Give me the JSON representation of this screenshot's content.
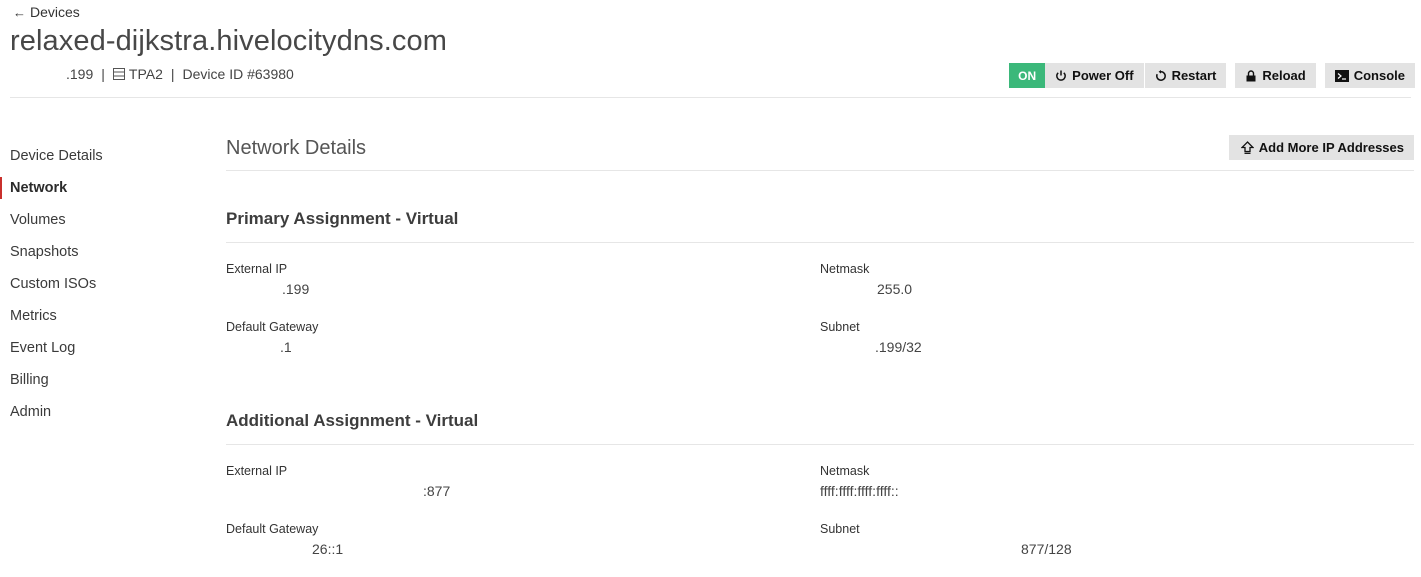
{
  "header": {
    "back_label": "Devices",
    "hostname": "relaxed-dijkstra.hivelocitydns.com",
    "ip_suffix": ".199",
    "location": "TPA2",
    "device_id": "Device ID #63980",
    "separator": "|"
  },
  "actions": {
    "status": "ON",
    "status_color": "#3bb87a",
    "power_off": "Power Off",
    "restart": "Restart",
    "reload": "Reload",
    "console": "Console"
  },
  "sidebar": {
    "items": [
      {
        "label": "Device Details"
      },
      {
        "label": "Network",
        "active": true
      },
      {
        "label": "Volumes"
      },
      {
        "label": "Snapshots"
      },
      {
        "label": "Custom ISOs"
      },
      {
        "label": "Metrics"
      },
      {
        "label": "Event Log"
      },
      {
        "label": "Billing"
      },
      {
        "label": "Admin"
      }
    ],
    "active_color": "#c9302c"
  },
  "main": {
    "title": "Network Details",
    "add_ip_label": "Add More IP Addresses",
    "primary": {
      "title": "Primary Assignment - Virtual",
      "external_ip_label": "External IP",
      "external_ip": ".199",
      "netmask_label": "Netmask",
      "netmask": "255.0",
      "gateway_label": "Default Gateway",
      "gateway": ".1",
      "subnet_label": "Subnet",
      "subnet": ".199/32"
    },
    "additional": {
      "title": "Additional Assignment - Virtual",
      "external_ip_label": "External IP",
      "external_ip": ":877",
      "netmask_label": "Netmask",
      "netmask": "ffff:ffff:ffff:ffff::",
      "gateway_label": "Default Gateway",
      "gateway": "26::1",
      "subnet_label": "Subnet",
      "subnet": "877/128"
    }
  }
}
